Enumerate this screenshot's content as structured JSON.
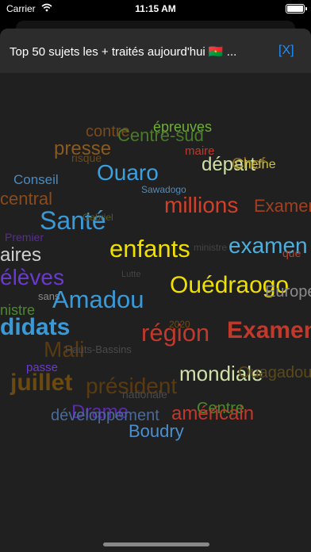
{
  "status": {
    "carrier": "Carrier",
    "time": "11:15 AM"
  },
  "header": {
    "title": "Top 50 sujets les + traités aujourd'hui 🇧🇫 ...",
    "close_label": "[X]"
  },
  "words": [
    {
      "text": "contre",
      "color": "#7a4a1a"
    },
    {
      "text": "épreuves",
      "color": "#6fae3a"
    },
    {
      "text": "Centre-sud",
      "color": "#4a7a2a"
    },
    {
      "text": "presse",
      "color": "#8a5a1e"
    },
    {
      "text": "maire",
      "color": "#c0392b"
    },
    {
      "text": "risque",
      "color": "#6a4a1a"
    },
    {
      "text": "départ",
      "color": "#cfe0a8"
    },
    {
      "text": "Chef",
      "color": "#8a6a20"
    },
    {
      "text": "Chefne",
      "color": "#c8c13a"
    },
    {
      "text": "Conseil",
      "color": "#4a8ac0"
    },
    {
      "text": "Ouaro",
      "color": "#3aa0e0"
    },
    {
      "text": "Sawadogo",
      "color": "#5a8ab0"
    },
    {
      "text": "central",
      "color": "#8a4a1a"
    },
    {
      "text": "millions",
      "color": "#d0402a"
    },
    {
      "text": "Examens",
      "color": "#a04020"
    },
    {
      "text": "Santé",
      "color": "#3a9ad8"
    },
    {
      "text": "Gabriel",
      "color": "#5a5a2a"
    },
    {
      "text": "Premier",
      "color": "#5a2aa0"
    },
    {
      "text": "enfants",
      "color": "#f0e000"
    },
    {
      "text": "ministre",
      "color": "#444444"
    },
    {
      "text": "examen",
      "color": "#4ab0e0"
    },
    {
      "text": "que",
      "color": "#c0402a"
    },
    {
      "text": "aires",
      "color": "#d0d0d0"
    },
    {
      "text": "élèves",
      "color": "#6a3ad0"
    },
    {
      "text": "Lutte",
      "color": "#444444"
    },
    {
      "text": "Ouédraogo",
      "color": "#f0e000"
    },
    {
      "text": "Europe",
      "color": "#8a8a8a"
    },
    {
      "text": "sans",
      "color": "#8a8a8a"
    },
    {
      "text": "Amadou",
      "color": "#3a9ad8"
    },
    {
      "text": "nistre",
      "color": "#4a8a2a"
    },
    {
      "text": "didats",
      "color": "#3a9ad8"
    },
    {
      "text": "2020",
      "color": "#6a4a1a"
    },
    {
      "text": "région",
      "color": "#c0392b"
    },
    {
      "text": "Examen",
      "color": "#c0392b"
    },
    {
      "text": "Mali",
      "color": "#5a3a10"
    },
    {
      "text": "Hauts-Bassins",
      "color": "#4a4a4a"
    },
    {
      "text": "passe",
      "color": "#6a3ad0"
    },
    {
      "text": "mondiale",
      "color": "#cfe0a8"
    },
    {
      "text": "Ouagadougou",
      "color": "#5a4a1a"
    },
    {
      "text": "juillet",
      "color": "#6a4a10"
    },
    {
      "text": "président",
      "color": "#5a3a10"
    },
    {
      "text": "nationale",
      "color": "#4a4a4a"
    },
    {
      "text": "Centre",
      "color": "#4a8a2a"
    },
    {
      "text": "Drame",
      "color": "#5a2ab0"
    },
    {
      "text": "développement",
      "color": "#4a6a9a"
    },
    {
      "text": "américain",
      "color": "#c0392b"
    },
    {
      "text": "Boudry",
      "color": "#4a90d0"
    }
  ]
}
